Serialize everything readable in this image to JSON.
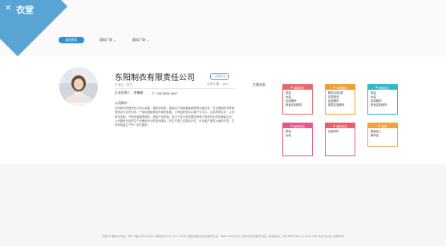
{
  "brand": {
    "logo_text": "衣堂",
    "logo_icon": "wings-icon"
  },
  "nav": {
    "back_label": "返回首页",
    "filters": [
      {
        "label": "面料广场",
        "close": "×"
      },
      {
        "label": "面料广场",
        "close": "×"
      }
    ]
  },
  "company": {
    "name": "东阳制衣有限责任公司",
    "follow_label": "+ 添加关注",
    "location": "浙江 · 金华",
    "people_count": "公司人数：100+",
    "legal_person_label": "企业负责人：",
    "legal_person": "李琳琳",
    "phone": "023-5535 2847",
    "intro_title": "公司简介：",
    "intro": "东阳制衣有限责任公司以染整、棉纺织科研、服装生产线和服装销售等主营业务，在全国拥有多家销售网点与合作伙伴，产品远销欧美及东南亚各国，公司始终坚持以客户为中心，以品质求生存，以创新求发展，不断完善管理体系，提高产品质量，致力于成为具有国际竞争力的现代化纺织服装企业。公司拥有先进的生产设备和专业的技术团队，年生产能力达数百万件，可为客户提供从面料开发、打样到批量生产的一站式服务。"
  },
  "main_business": {
    "label": "主营业务",
    "categories": [
      {
        "title": "面料设计",
        "icon": "scissors-icon",
        "color": "#e86a6a",
        "items": [
          "男装",
          "女装",
          "民族服饰",
          "修身定制服饰"
        ]
      },
      {
        "title": "可靠面料",
        "icon": "thread-icon",
        "color": "#f0a030",
        "items": [
          "睡衣定制(男)",
          "袜类制品",
          "民族服饰",
          "婴童定制服饰"
        ]
      },
      {
        "title": "面料加工",
        "icon": "needle-icon",
        "color": "#31b8c8",
        "items": [
          "男装",
          "女装",
          "民族服饰",
          "修身定制服饰"
        ]
      },
      {
        "title": "面料供应",
        "icon": "fabric-icon",
        "color": "#e8568a",
        "items": [
          "男装",
          "女装"
        ]
      },
      {
        "title": "辅料供应",
        "icon": "button-icon",
        "color": "#ea5d6d",
        "items": [
          "包装材料"
        ]
      },
      {
        "title": "服饰",
        "icon": "shirt-icon",
        "color": "#f2a33a",
        "items": [
          "服装加工",
          "服饰品"
        ]
      }
    ]
  },
  "footer": {
    "text": "网站ICP备案许可证：粤ICP备14052155号 | 粤网文[2016] 1677-134号 | 增值电信业务经营许可证：粤B2-20160155 | 网络文化经营许可证 | 客服电话：020-88002682 | © 2004-2016 北京衣之家 版权所有"
  }
}
